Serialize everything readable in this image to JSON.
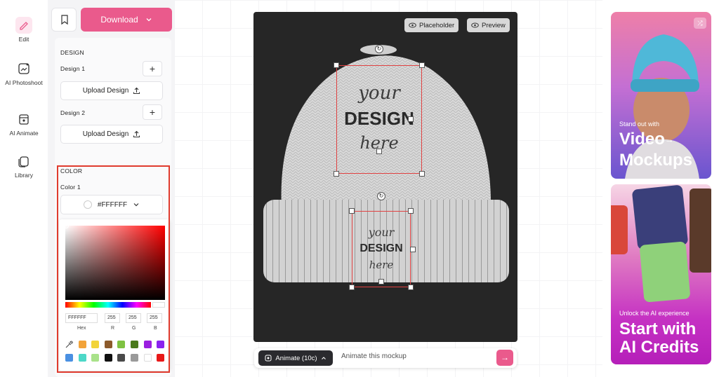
{
  "rail": {
    "items": [
      {
        "label": "Edit"
      },
      {
        "label": "AI Photoshoot"
      },
      {
        "label": "AI Animate"
      },
      {
        "label": "Library"
      }
    ]
  },
  "toolbar": {
    "download_label": "Download"
  },
  "design": {
    "section_label": "DESIGN",
    "design1_label": "Design 1",
    "design2_label": "Design 2",
    "upload_label": "Upload Design"
  },
  "color": {
    "section_label": "COLOR",
    "color1_label": "Color 1",
    "selected_hex": "#FFFFFF",
    "picker": {
      "hex_value": "FFFFFF",
      "r_value": "255",
      "g_value": "255",
      "b_value": "255",
      "hex_label": "Hex",
      "r_label": "R",
      "g_label": "G",
      "b_label": "B",
      "presets": [
        "#f2a33a",
        "#f2d43a",
        "#8c5a2b",
        "#7fc242",
        "#4a7a1c",
        "#9b1ee0",
        "#8a22f0",
        "#4a90e2",
        "#4dd8c8",
        "#a9e28a",
        "#111111",
        "#4a4a4a",
        "#9a9a9a",
        "#ffffff",
        "#e81818"
      ]
    }
  },
  "mockup": {
    "placeholder_label": "Placeholder",
    "preview_label": "Preview",
    "design_text_1": "your",
    "design_text_2": "DESIGN",
    "design_text_3": "here"
  },
  "animate": {
    "button_label": "Animate (10c)",
    "input_placeholder": "Animate this mockup"
  },
  "ads": [
    {
      "small": "Stand out with",
      "big1": "Video",
      "big2": "Mockups"
    },
    {
      "small": "Unlock the AI experience",
      "big1": "Start with",
      "big2": "AI Credits"
    }
  ],
  "colors": {
    "accent": "#ea5a8c",
    "highlight": "#e03b2e"
  }
}
